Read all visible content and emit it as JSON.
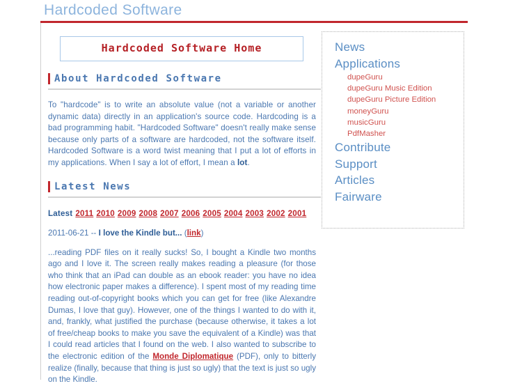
{
  "site": {
    "logo_text": "Hardcoded Software",
    "accent_red": "#c1272d",
    "accent_blue": "#4a77b0",
    "link_red": "#c1272d",
    "sidebar_blue": "#5a8ec4",
    "sidebar_red": "#d0524f"
  },
  "header": {
    "page_title": "Hardcoded Software Home"
  },
  "about": {
    "heading": "About Hardcoded Software",
    "paragraph_part1": "To \"hardcode\" is to write an absolute value (not a variable or another dynamic data) directly in an application's source code. Hardcoding is a bad programming habit. \"Hardcoded Software\" doesn't really make sense because only parts of a software are hardcoded, not the software itself. Hardcoded Software is a word twist meaning that I put a lot of efforts in my applications. When I say a lot of effort, I mean a ",
    "paragraph_bold": "lot",
    "paragraph_part2": "."
  },
  "news": {
    "heading": "Latest News",
    "latest_label": "Latest",
    "years": [
      "2011",
      "2010",
      "2009",
      "2008",
      "2007",
      "2006",
      "2005",
      "2004",
      "2003",
      "2002",
      "2001"
    ],
    "entry": {
      "date": "2011-06-21",
      "separator": "--",
      "title": "I love the Kindle but...",
      "open_paren": "(",
      "link_label": "link",
      "close_paren": ")",
      "body_part1": "...reading PDF files on it really sucks! So, I bought a Kindle two months ago and I love it. The screen really makes reading a pleasure (for those who think that an iPad can double as an ebook reader: you have no idea how electronic paper makes a difference). I spent most of my reading time reading out-of-copyright books which you can get for free (like Alexandre Dumas, I love that guy). However, one of the things I wanted to do with it, and, frankly, what justified the purchase (because otherwise, it takes a lot of free/cheap books to make you save the equivalent of a Kindle) was that I could read articles that I found on the web. I also wanted to subscribe to the electronic edition of the ",
      "body_link": "Monde Diplomatique",
      "body_part2": " (PDF), only to bitterly realize (finally, because that thing is just so ugly) that the text is just so ugly on the Kindle."
    }
  },
  "sidebar": {
    "items": [
      {
        "label": "News",
        "type": "main"
      },
      {
        "label": "Applications",
        "type": "main"
      },
      {
        "label": "dupeGuru",
        "type": "sub"
      },
      {
        "label": "dupeGuru Music Edition",
        "type": "sub"
      },
      {
        "label": "dupeGuru Picture Edition",
        "type": "sub"
      },
      {
        "label": "moneyGuru",
        "type": "sub"
      },
      {
        "label": "musicGuru",
        "type": "sub"
      },
      {
        "label": "PdfMasher",
        "type": "sub"
      },
      {
        "label": "Contribute",
        "type": "main"
      },
      {
        "label": "Support",
        "type": "main"
      },
      {
        "label": "Articles",
        "type": "main"
      },
      {
        "label": "Fairware",
        "type": "main"
      }
    ]
  }
}
